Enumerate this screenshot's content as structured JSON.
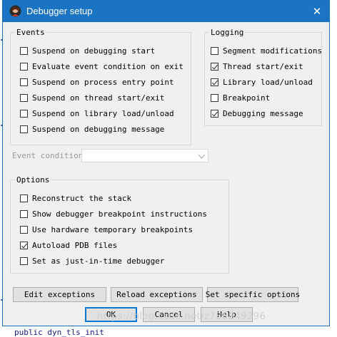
{
  "window": {
    "title": "Debugger setup",
    "icon": "ida-app-icon",
    "close_glyph": "✕"
  },
  "events": {
    "legend": "Events",
    "items": [
      {
        "label": "Suspend on debugging start",
        "checked": false
      },
      {
        "label": "Evaluate event condition on exit",
        "checked": false
      },
      {
        "label": "Suspend on process entry point",
        "checked": false
      },
      {
        "label": "Suspend on thread start/exit",
        "checked": false
      },
      {
        "label": "Suspend on library load/unload",
        "checked": false
      },
      {
        "label": "Suspend on debugging message",
        "checked": false
      }
    ]
  },
  "logging": {
    "legend": "Logging",
    "items": [
      {
        "label": "Segment modifications",
        "checked": false
      },
      {
        "label": "Thread start/exit",
        "checked": true
      },
      {
        "label": "Library load/unload",
        "checked": true
      },
      {
        "label": "Breakpoint",
        "checked": false
      },
      {
        "label": "Debugging message",
        "checked": true
      }
    ]
  },
  "event_condition": {
    "label": "Event condition",
    "value": ""
  },
  "options": {
    "legend": "Options",
    "items": [
      {
        "label": "Reconstruct the stack",
        "checked": false
      },
      {
        "label": "Show debugger breakpoint instructions",
        "checked": false
      },
      {
        "label": "Use hardware temporary breakpoints",
        "checked": false
      },
      {
        "label": "Autoload PDB files",
        "checked": true
      },
      {
        "label": "Set as just-in-time debugger",
        "checked": false
      }
    ]
  },
  "buttons": {
    "edit_exceptions": "Edit exceptions",
    "reload_exceptions": "Reload exceptions",
    "set_specific_options": "Set specific options",
    "ok": "OK",
    "cancel": "Cancel",
    "help": "Help"
  },
  "watermark": "https://blog.csdn.net/z786849296",
  "background_code": "public   dyn_tls_init"
}
